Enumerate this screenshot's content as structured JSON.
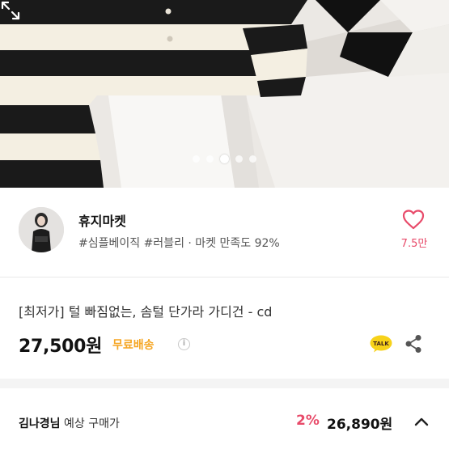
{
  "gallery": {
    "slide_count": 5,
    "active_index": 2
  },
  "seller": {
    "name": "휴지마켓",
    "tags": "#심플베이직 #러블리 · 마켓 만족도 92%",
    "likes": "7.5만"
  },
  "product": {
    "title": "[최저가] 털 빠짐없는, 솜털 단가라 가디건 - cd",
    "price": "27,500원",
    "shipping": "무료배송",
    "info_icon": "i",
    "talk_label": "TALK"
  },
  "buyer_price": {
    "name": "김나경님",
    "label": "예상 구매가",
    "discount": "2%",
    "price": "26,890원"
  },
  "colors": {
    "accent_pink": "#e84b6a",
    "shipping_orange": "#f5a623",
    "talk_yellow": "#f7d21a"
  },
  "icons": [
    "expand-icon",
    "heart-icon",
    "info-icon",
    "talk-icon",
    "share-icon",
    "chevron-up-icon"
  ]
}
